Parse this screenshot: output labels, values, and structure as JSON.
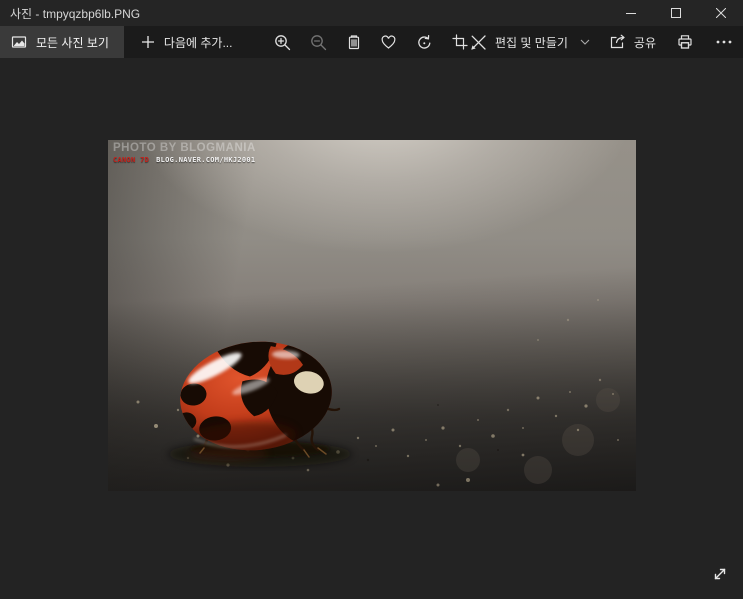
{
  "window": {
    "title": "사진 - tmpyqzbp6lb.PNG",
    "app_name": "사진"
  },
  "toolbar": {
    "view_all_photos": "모든 사진 보기",
    "add_to": "다음에 추가...",
    "edit_create": "편집 및 만들기",
    "share": "공유"
  },
  "photo": {
    "subject": "macro photo of a red and black ladybug on a dark reflective surface",
    "watermark": {
      "line1": "PHOTO BY BLOGMANIA",
      "camera": "CANON 7D",
      "url": "BLOG.NAVER.COM/HKJ2001"
    }
  },
  "icons": {
    "view-all-photos-icon": "🖼",
    "add-icon": "+",
    "zoom-in-icon": "🔍+",
    "zoom-out-icon": "🔍−",
    "delete-icon": "🗑",
    "favorite-icon": "♡",
    "rotate-icon": "↻",
    "crop-icon": "⌗",
    "edit-create-icon": "✎✂",
    "chevron-down-icon": "⌄",
    "share-icon": "↗",
    "print-icon": "🖨",
    "see-more-icon": "⋯",
    "minimize-icon": "–",
    "maximize-icon": "□",
    "close-icon": "✕",
    "fullscreen-icon": "⤢"
  },
  "colors": {
    "titlebar": "#252525",
    "toolbar": "#1b1b1b",
    "selected_button": "#3a3a3a",
    "content_background": "#232323",
    "icon_color": "#e0e0e0",
    "disabled_icon": "#6f6f6f",
    "watermark_red": "#c6201a",
    "ladybug_red": "#c8421f"
  },
  "states": {
    "zoom_out_disabled": true,
    "view_all_photos_selected": true
  }
}
